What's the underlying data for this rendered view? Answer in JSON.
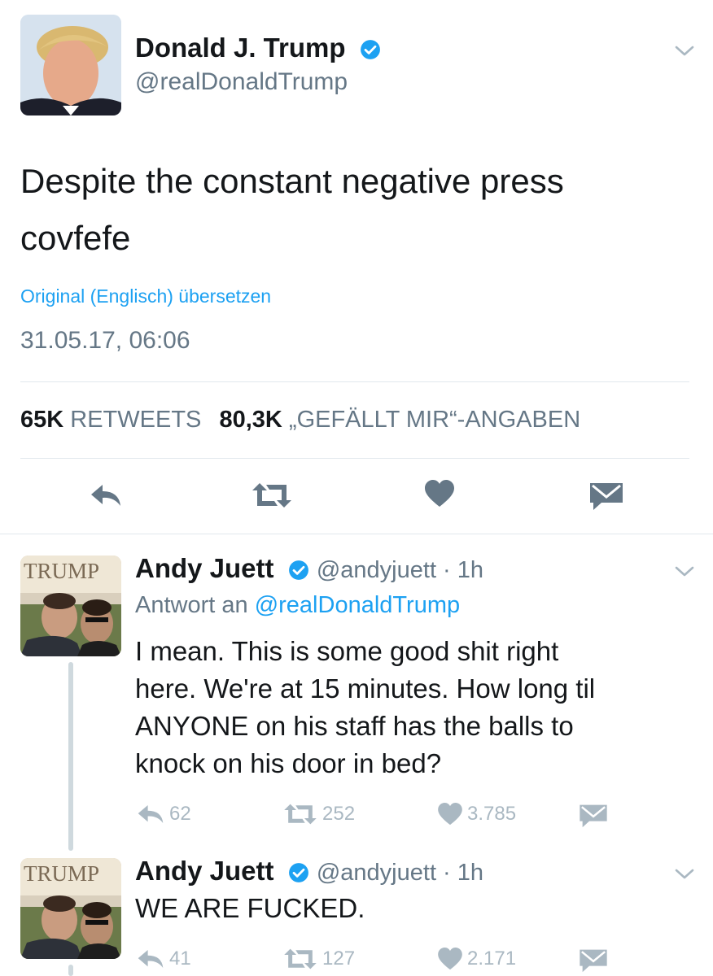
{
  "main_tweet": {
    "author_name": "Donald J. Trump",
    "handle": "@realDonaldTrump",
    "text_lines": [
      "Despite the constant negative press",
      "covfefe"
    ],
    "translate_link": "Original (Englisch) übersetzen",
    "timestamp": "31.05.17, 06:06",
    "retweets_count": "65K",
    "retweets_label": "RETWEETS",
    "likes_count": "80,3K",
    "likes_label": "„GEFÄLLT MIR“-ANGABEN",
    "actions": [
      "reply-icon",
      "retweet-icon",
      "heart-icon",
      "mail-icon"
    ]
  },
  "replies": [
    {
      "author_name": "Andy Juett",
      "handle_time": "@andyjuett · 1h",
      "reply_to_prefix": "Antwort an",
      "reply_to_handle": "@realDonaldTrump",
      "text_lines": [
        "I mean. This is some good shit right",
        "here. We're at 15 minutes. How long til",
        "ANYONE on his staff has the balls to",
        "knock on his door in bed?"
      ],
      "reply_count": "62",
      "retweet_count": "252",
      "like_count": "3.785"
    },
    {
      "author_name": "Andy Juett",
      "handle_time": "@andyjuett · 1h",
      "text_lines": [
        "WE ARE FUCKED."
      ],
      "reply_count": "41",
      "retweet_count": "127",
      "like_count": "2.171"
    }
  ],
  "avatar_sign_text": "TRUMP",
  "colors": {
    "text": "#14171a",
    "secondary": "#657786",
    "link": "#1da1f2",
    "icon_light": "#aab8c2",
    "divider": "#e1e8ed"
  }
}
